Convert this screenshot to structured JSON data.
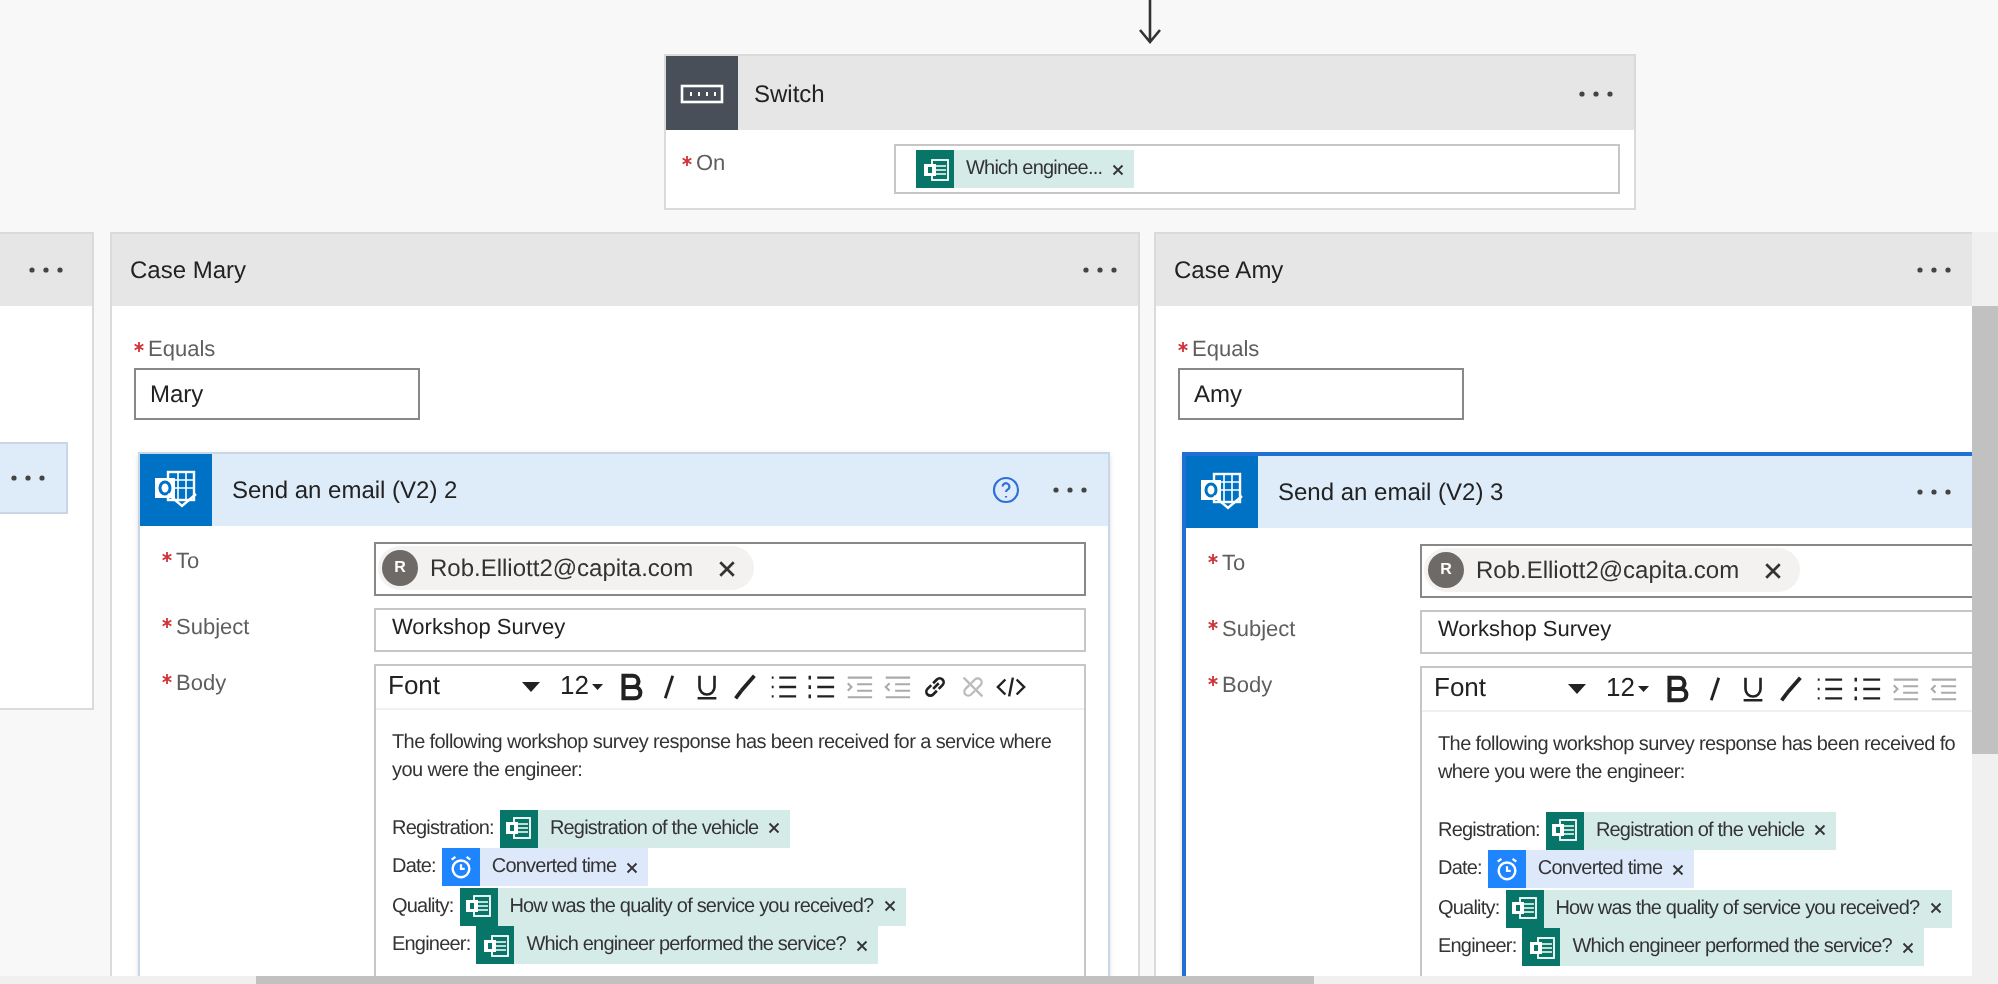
{
  "switch": {
    "title": "Switch",
    "on_label": "On",
    "token": {
      "kind": "forms",
      "text": "Which enginee..."
    }
  },
  "cases": [
    {
      "kind": "partial"
    },
    {
      "kind": "full",
      "title": "Case Mary",
      "equals_label": "Equals",
      "equals": "Mary",
      "action": {
        "title": "Send an email (V2) 2",
        "selected": false,
        "help": true,
        "to_label": "To",
        "avatar": "R",
        "to": "Rob.Elliott2@capita.com",
        "subject_label": "Subject",
        "subject": "Workshop Survey",
        "body_label": "Body",
        "font": "Font",
        "size": "12",
        "body_lines": [
          "The following workshop survey response has been received for a service where",
          "you were the engineer:"
        ],
        "fields": [
          {
            "label": "Registration:",
            "kind": "forms",
            "token": "Registration of the vehicle"
          },
          {
            "label": "Date:",
            "kind": "time",
            "token": "Converted time"
          },
          {
            "label": "Quality:",
            "kind": "forms",
            "token": "How was the quality of service you received?"
          },
          {
            "label": "Engineer:",
            "kind": "forms",
            "token": "Which engineer performed the service?"
          }
        ]
      }
    },
    {
      "kind": "full",
      "title": "Case Amy",
      "equals_label": "Equals",
      "equals": "Amy",
      "action": {
        "title": "Send an email (V2) 3",
        "selected": true,
        "help": false,
        "to_label": "To",
        "avatar": "R",
        "to": "Rob.Elliott2@capita.com",
        "subject_label": "Subject",
        "subject": "Workshop Survey",
        "body_label": "Body",
        "font": "Font",
        "size": "12",
        "body_lines": [
          "The following workshop survey response has been received fo",
          "where you were the engineer:"
        ],
        "fields": [
          {
            "label": "Registration:",
            "kind": "forms",
            "token": "Registration of the vehicle"
          },
          {
            "label": "Date:",
            "kind": "time",
            "token": "Converted time"
          },
          {
            "label": "Quality:",
            "kind": "forms",
            "token": "How was the quality of service you received?"
          },
          {
            "label": "Engineer:",
            "kind": "forms",
            "token": "Which engineer performed the service?"
          }
        ]
      }
    }
  ]
}
